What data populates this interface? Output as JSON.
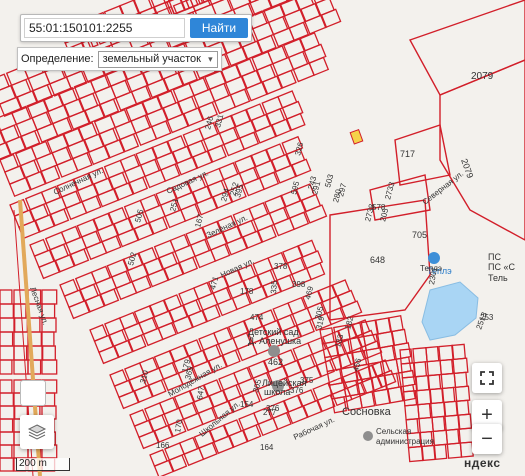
{
  "search": {
    "value": "55:01:150101:2255",
    "button_label": "Найти"
  },
  "definition": {
    "label": "Определение:",
    "selected": "земельный участок"
  },
  "scale_label": "200 m",
  "attribution": "ндекс",
  "colors": {
    "parcel": "#d21f2a",
    "water": "#a9d5f4",
    "accent": "#2f86d8",
    "highlight": "#f5d24a",
    "background": "#f3f1ed"
  },
  "icons": {
    "layers": "layers-icon",
    "fullscreen": "fullscreen-icon",
    "zoom_in": "plus-icon",
    "zoom_out": "minus-icon",
    "school": "school-icon",
    "kindergarten": "kindergarten-icon",
    "heat": "drop-icon"
  },
  "map_labels": [
    "2079",
    "2079",
    "717",
    "705",
    "648",
    "578",
    "Северная ул.",
    "Теплэ",
    "ПС",
    "ПС «С",
    "Тель",
    "2301",
    "2513",
    "462",
    "Детский сад",
    "Д. Аленушка",
    "Лицейская",
    "школа",
    "Сосновка",
    "Сельская",
    "администрация",
    "Молодёжная ул.",
    "Школьная ул.",
    "Рабочая ул.",
    "Солнечная ул.",
    "Садовая ул.",
    "Зелёная ул.",
    "Новая ул.",
    "Лесная ул.",
    "376",
    "375",
    "378",
    "335",
    "398",
    "456",
    "179",
    "310",
    "647",
    "170",
    "166",
    "164",
    "154",
    "253",
    "2738",
    "326",
    "291",
    "502",
    "505",
    "503",
    "297",
    "305",
    "469",
    "319",
    "182",
    "183",
    "167",
    "251",
    "294",
    "331",
    "395",
    "246",
    "252",
    "243",
    "280",
    "205",
    "2733",
    "595",
    "277",
    "376",
    "305",
    "178",
    "474",
    "471",
    "369",
    "310"
  ]
}
